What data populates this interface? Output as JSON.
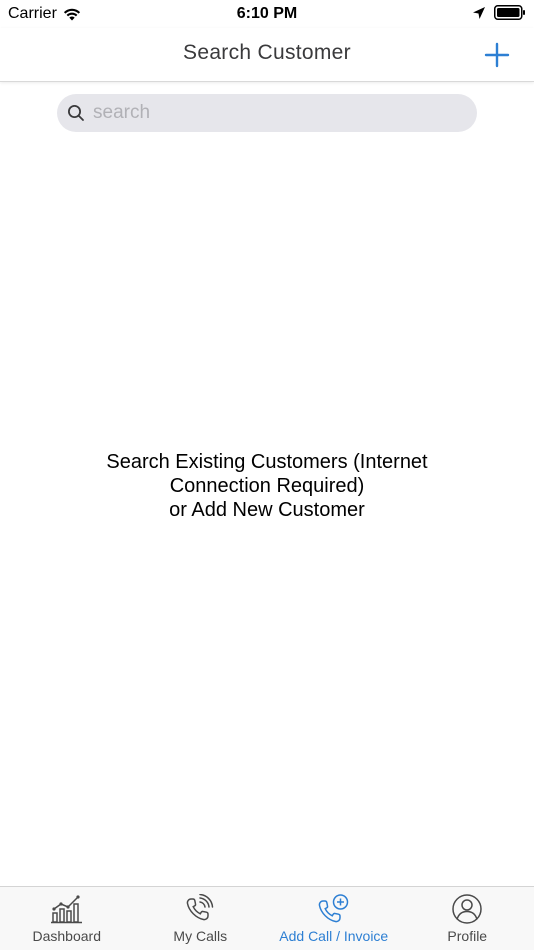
{
  "status_bar": {
    "carrier": "Carrier",
    "time": "6:10 PM"
  },
  "nav": {
    "title": "Search Customer",
    "add_icon": "plus-icon"
  },
  "search": {
    "placeholder": "search",
    "value": ""
  },
  "empty_state": {
    "line1": "Search Existing Customers (Internet",
    "line2": "Connection Required)",
    "line3": "or Add New Customer"
  },
  "tabs": [
    {
      "label": "Dashboard",
      "icon": "bar-chart-icon",
      "active": false
    },
    {
      "label": "My Calls",
      "icon": "phone-ringing-icon",
      "active": false
    },
    {
      "label": "Add Call / Invoice",
      "icon": "phone-plus-icon",
      "active": true
    },
    {
      "label": "Profile",
      "icon": "user-circle-icon",
      "active": false
    }
  ],
  "colors": {
    "accent": "#2d7fd3",
    "tab_inactive": "#4a4a4a",
    "search_bg": "#e6e6eb"
  }
}
